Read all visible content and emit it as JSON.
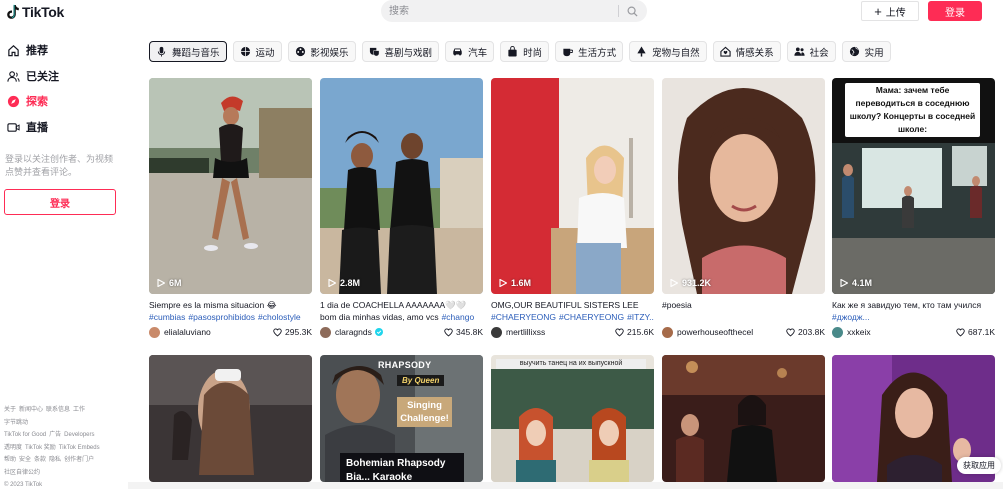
{
  "header": {
    "logo_text": "TikTok",
    "search_placeholder": "搜索",
    "upload_label": "上传",
    "login_label": "登录"
  },
  "sidebar": {
    "items": [
      {
        "label": "推荐",
        "icon": "home-icon",
        "active": false
      },
      {
        "label": "已关注",
        "icon": "following-icon",
        "active": false
      },
      {
        "label": "探索",
        "icon": "explore-icon",
        "active": true
      },
      {
        "label": "直播",
        "icon": "live-icon",
        "active": false
      }
    ],
    "hint": "登录以关注创作者、为视频点赞并查看评论。",
    "login_label": "登录",
    "footer": [
      [
        "关于",
        "新闻中心",
        "联系信息",
        "工作"
      ],
      [
        "字节跳动"
      ],
      [
        "TikTok for Good",
        "广告",
        "Developers"
      ],
      [
        "透明度",
        "TikTok 奖励",
        "TikTok Embeds"
      ],
      [
        "帮助",
        "安全",
        "条款",
        "隐私",
        "创作者门户"
      ],
      [
        "社区自律公约"
      ],
      [
        "© 2023 TikTok"
      ]
    ]
  },
  "chips": [
    {
      "label": "舞蹈与音乐",
      "icon": "mic-icon",
      "selected": true
    },
    {
      "label": "运动",
      "icon": "ball-icon",
      "selected": false
    },
    {
      "label": "影视娱乐",
      "icon": "film-icon",
      "selected": false
    },
    {
      "label": "喜剧与戏剧",
      "icon": "theater-icon",
      "selected": false
    },
    {
      "label": "汽车",
      "icon": "car-icon",
      "selected": false
    },
    {
      "label": "时尚",
      "icon": "bag-icon",
      "selected": false
    },
    {
      "label": "生活方式",
      "icon": "cup-icon",
      "selected": false
    },
    {
      "label": "宠物与自然",
      "icon": "tree-icon",
      "selected": false
    },
    {
      "label": "情感关系",
      "icon": "house-icon",
      "selected": false
    },
    {
      "label": "社会",
      "icon": "people-icon",
      "selected": false
    },
    {
      "label": "实用",
      "icon": "globe-icon",
      "selected": false
    }
  ],
  "videos": [
    {
      "views": "6M",
      "caption": "Siempre es la misma situacion 😂",
      "text": "",
      "tags": [
        "#cumbias",
        "#pasosprohibidos",
        "#cholostyle"
      ],
      "author": "elialaluviano",
      "verified": false,
      "likes": "295.3K",
      "avatar_color": "#c98a6a"
    },
    {
      "views": "2.8M",
      "caption": "1 dia de COACHELLA AAAAAAA🤍🤍",
      "text": "bom dia minhas vidas, amo vcs",
      "tags": [
        "#chango"
      ],
      "author": "claragnds",
      "verified": true,
      "likes": "345.8K",
      "avatar_color": "#8d6b5a"
    },
    {
      "views": "1.6M",
      "caption": "OMG,OUR BEAUTIFUL SISTERS LEE",
      "text": "",
      "tags": [
        "#CHAERYEONG",
        "#CHAERYEONG",
        "#ITZY..."
      ],
      "author": "mertlillixss",
      "verified": false,
      "likes": "215.6K",
      "avatar_color": "#3a3a3a"
    },
    {
      "views": "931.2K",
      "caption": "#poesia",
      "text": "",
      "tags": [],
      "author": "powerhouseofthecel",
      "verified": false,
      "likes": "203.8K",
      "avatar_color": "#a66b4a"
    },
    {
      "views": "4.1M",
      "caption": "Как же я завидую тем, кто там учился",
      "text": "",
      "tags": [
        "#джодж..."
      ],
      "author": "xxkeix",
      "verified": false,
      "likes": "687.1K",
      "avatar_color": "#4a8a8a"
    }
  ],
  "overlays": {
    "ru_text": "Мама: зачем тебе переводиться в соседнюю школу? Концерты в соседней школе:",
    "rhapsody": "RHAPSODY",
    "by_queen": "By Queen",
    "singing": "Singing Challenge!",
    "bohemian": "Bohemian Rhapsody",
    "bohemian_more": "Bia... Karaoke",
    "strip": "выучить танец на их выпускной"
  },
  "collapse_label": "获取应用",
  "colors": {
    "brand": "#fe2c55",
    "hashtag": "#2b5db9",
    "text": "#161823"
  }
}
